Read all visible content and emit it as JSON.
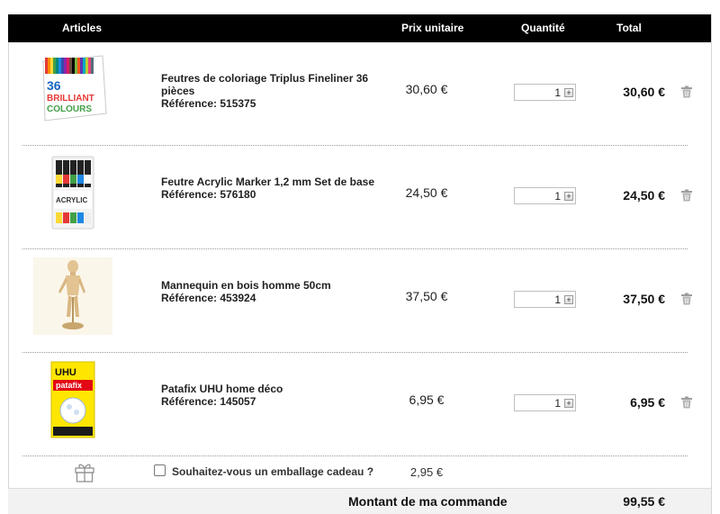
{
  "header": {
    "articles": "Articles",
    "unit_price": "Prix unitaire",
    "quantity": "Quantité",
    "total": "Total"
  },
  "items": [
    {
      "name": "Feutres de coloriage Triplus Fineliner 36 pièces",
      "reference": "Référence: 515375",
      "unit_price": "30,60 €",
      "quantity": "1",
      "total": "30,60 €",
      "thumbnail_text": [
        "36",
        "BRILLIANT",
        "COLOURS"
      ]
    },
    {
      "name": "Feutre Acrylic Marker 1,2 mm Set de base",
      "reference": "Référence: 576180",
      "unit_price": "24,50 €",
      "quantity": "1",
      "total": "24,50 €",
      "thumbnail_text": [
        "ACRYLIC"
      ]
    },
    {
      "name": "Mannequin en bois homme 50cm",
      "reference": "Référence: 453924",
      "unit_price": "37,50 €",
      "quantity": "1",
      "total": "37,50 €"
    },
    {
      "name": "Patafix UHU home déco",
      "reference": "Référence: 145057",
      "unit_price": "6,95 €",
      "quantity": "1",
      "total": "6,95 €",
      "thumbnail_text": [
        "UHU",
        "patafix"
      ]
    }
  ],
  "gift_wrap": {
    "label": "Souhaitez-vous un emballage cadeau ?",
    "price": "2,95 €",
    "checked": false
  },
  "summary": {
    "label": "Montant de ma commande",
    "amount": "99,55 €"
  },
  "icons": {
    "remove": "trash-icon",
    "gift": "gift-icon",
    "increment": "plus-icon"
  }
}
